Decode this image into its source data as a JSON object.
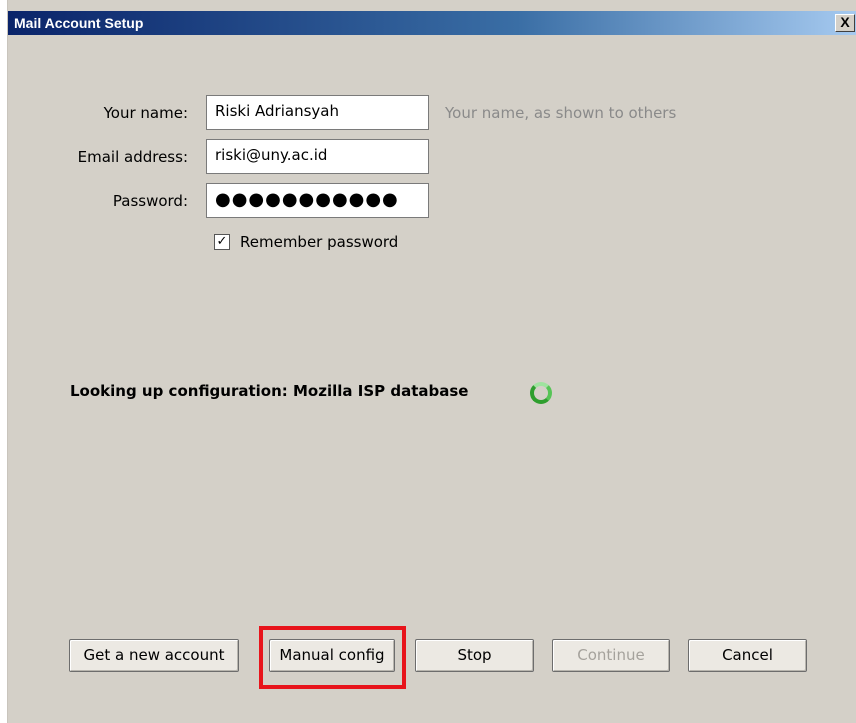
{
  "window": {
    "title": "Mail Account Setup",
    "close_label": "X"
  },
  "form": {
    "name_label": "Your name:",
    "name_value": "Riski Adriansyah",
    "name_hint": "Your name, as shown to others",
    "email_label": "Email address:",
    "email_value": "riski@uny.ac.id",
    "password_label": "Password:",
    "password_value": "●●●●●●●●●●●",
    "remember_label": "Remember password",
    "remember_checked": true
  },
  "status": {
    "text": "Looking up configuration: Mozilla ISP database",
    "spinner_icon": "loading-spinner-icon"
  },
  "buttons": {
    "new_account": "Get a new account",
    "manual_config": "Manual config",
    "stop": "Stop",
    "continue": "Continue",
    "cancel": "Cancel"
  },
  "colors": {
    "highlight": "#e8141b",
    "spinner": "#2e9e2e",
    "title_bar": "#0a246a"
  }
}
